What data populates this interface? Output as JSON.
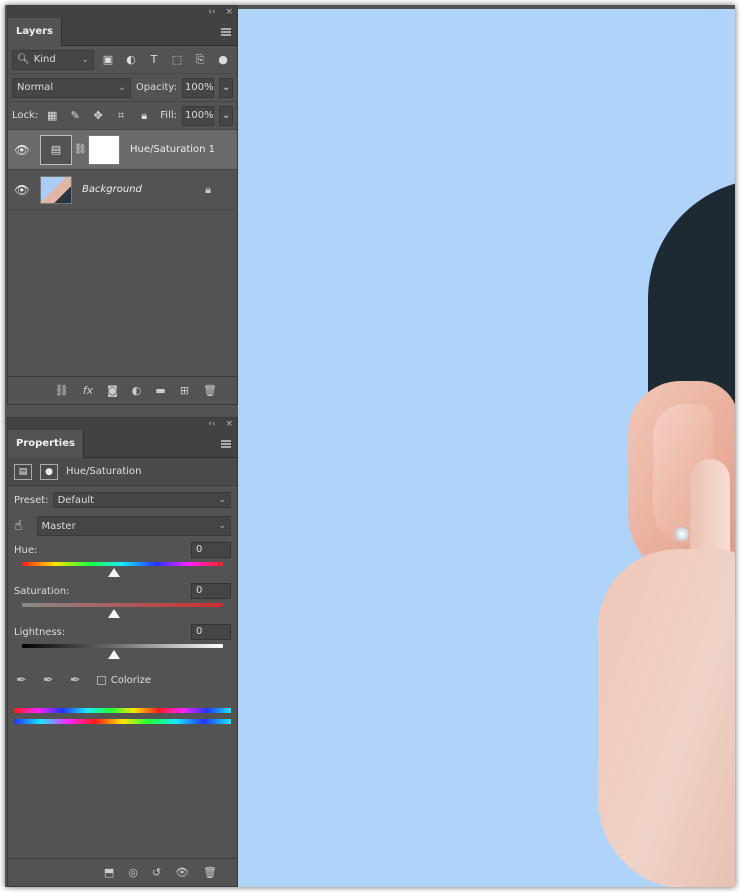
{
  "layers_panel": {
    "tab": "Layers",
    "collapse_glyph": "‹‹",
    "close_glyph": "×",
    "filter_kind": "Kind",
    "blend_mode": "Normal",
    "opacity_label": "Opacity:",
    "opacity_value": "100%",
    "lock_label": "Lock:",
    "fill_label": "Fill:",
    "fill_value": "100%",
    "layers": [
      {
        "name": "Hue/Saturation 1",
        "selected": true
      },
      {
        "name": "Background",
        "selected": false
      }
    ]
  },
  "properties_panel": {
    "tab": "Properties",
    "collapse_glyph": "‹‹",
    "close_glyph": "×",
    "adjustment_title": "Hue/Saturation",
    "preset_label": "Preset:",
    "preset_value": "Default",
    "channel_value": "Master",
    "hue_label": "Hue:",
    "hue_value": "0",
    "saturation_label": "Saturation:",
    "saturation_value": "0",
    "lightness_label": "Lightness:",
    "lightness_value": "0",
    "colorize_label": "Colorize",
    "colorize_checked": false
  }
}
